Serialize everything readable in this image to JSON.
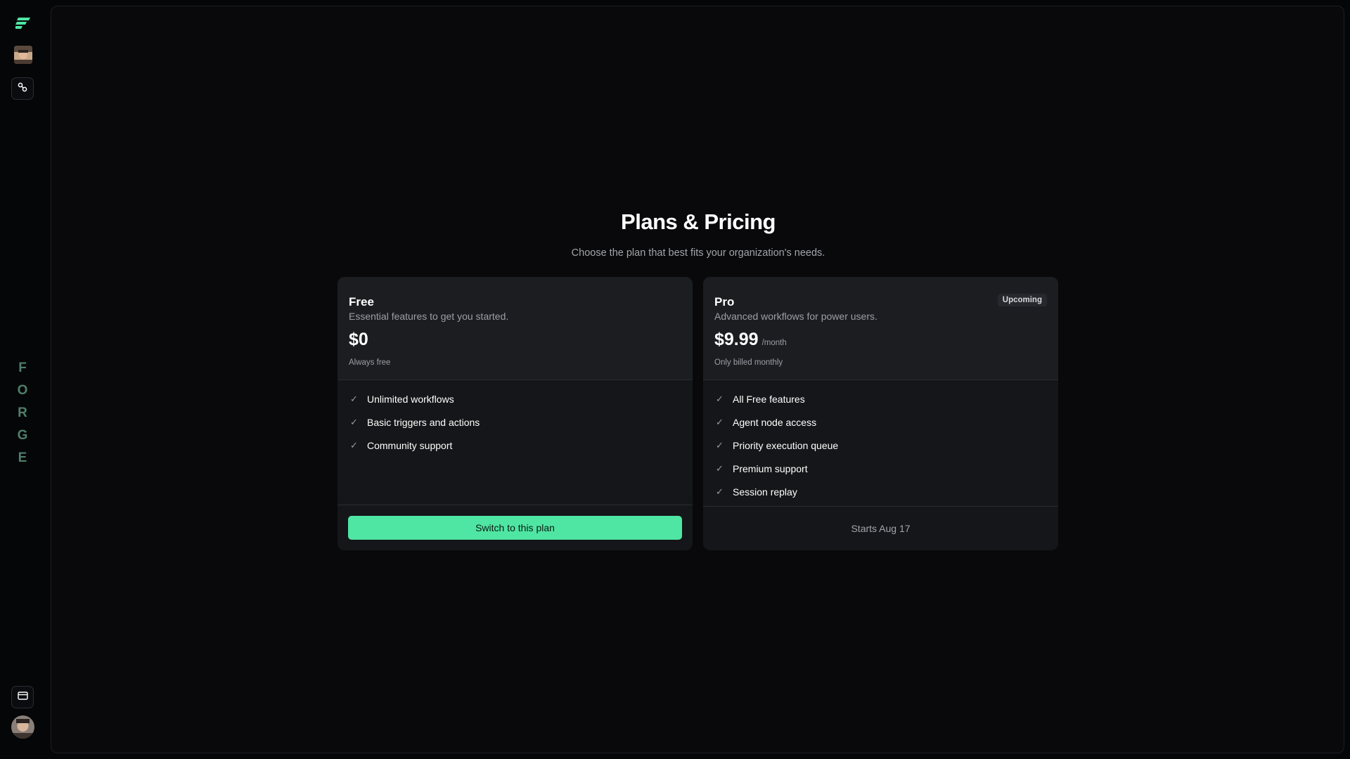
{
  "sidebar": {
    "brand_letters": [
      "F",
      "O",
      "R",
      "G",
      "E"
    ],
    "icons": {
      "logo": "forge-logo-icon",
      "workflows": "link-icon",
      "billing": "credit-card-icon"
    },
    "accent_color": "#4fe6a3"
  },
  "page": {
    "title": "Plans & Pricing",
    "subtitle": "Choose the plan that best fits your organization's needs."
  },
  "plans": [
    {
      "name": "Free",
      "description": "Essential features to get you started.",
      "price": "$0",
      "period": "",
      "note": "Always free",
      "features": [
        "Unlimited workflows",
        "Basic triggers and actions",
        "Community support"
      ],
      "cta": "Switch to this plan"
    },
    {
      "name": "Pro",
      "badge": "Upcoming",
      "description": "Advanced workflows for power users.",
      "price": "$9.99",
      "period": "/month",
      "note": "Only billed monthly",
      "features": [
        "All Free features",
        "Agent node access",
        "Priority execution queue",
        "Premium support",
        "Session replay"
      ],
      "footer_note": "Starts Aug 17"
    }
  ]
}
